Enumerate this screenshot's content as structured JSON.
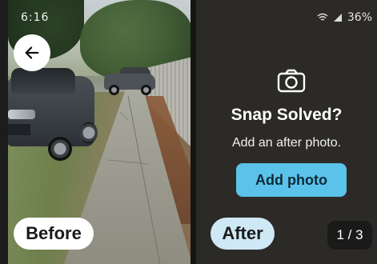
{
  "status_bar": {
    "time": "6:16",
    "battery": "36%"
  },
  "before_panel": {
    "label": "Before"
  },
  "after_panel": {
    "title": "Snap Solved?",
    "subtitle": "Add an after photo.",
    "add_photo_label": "Add photo",
    "label": "After"
  },
  "pager": {
    "counter": "1 / 3"
  },
  "icons": {
    "back": "arrow-left-icon",
    "camera": "camera-icon"
  },
  "colors": {
    "accent": "#5bc2ea",
    "after_pill": "#cfe8f6",
    "panel_dark": "#2c2a26"
  }
}
